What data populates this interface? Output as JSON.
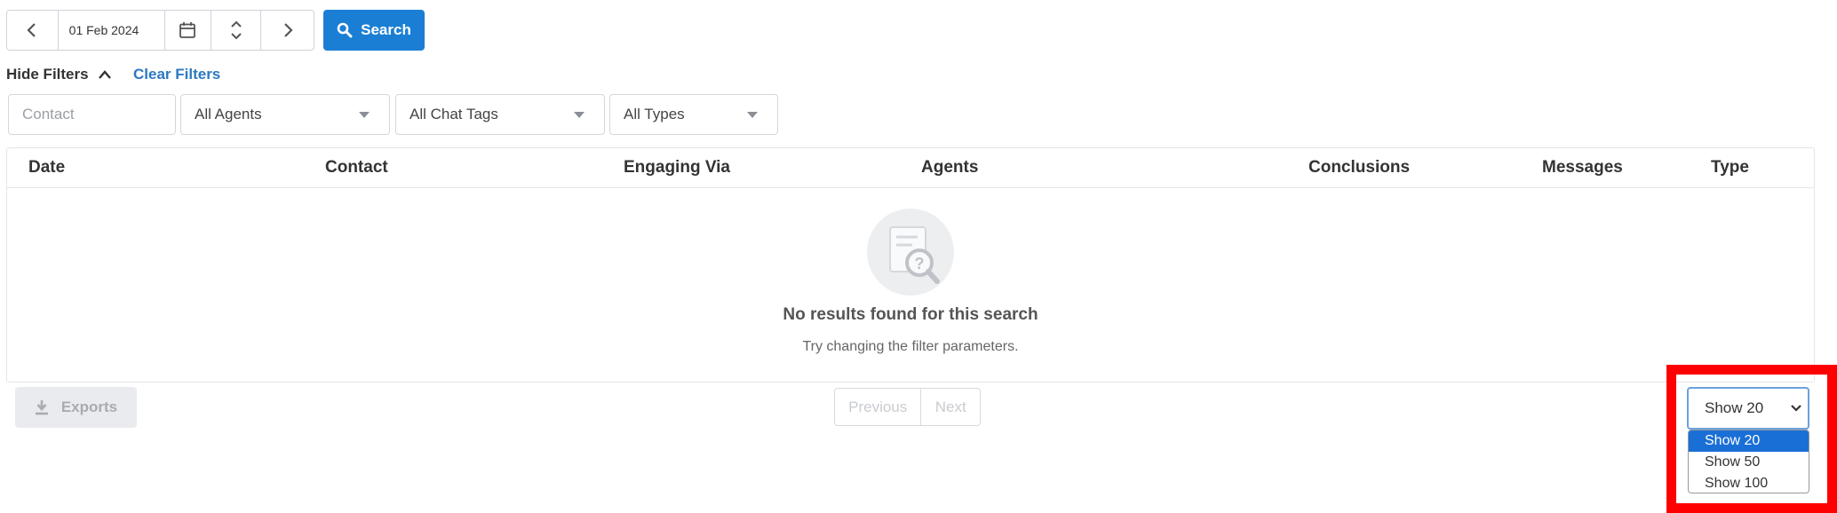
{
  "date_nav": {
    "date_value": "01 Feb 2024",
    "search_label": "Search"
  },
  "filters": {
    "hide_label": "Hide Filters",
    "clear_label": "Clear Filters",
    "contact_placeholder": "Contact",
    "agents_value": "All Agents",
    "chat_tags_value": "All Chat Tags",
    "types_value": "All Types"
  },
  "table": {
    "columns": [
      "Date",
      "Contact",
      "Engaging Via",
      "Agents",
      "Conclusions",
      "Messages",
      "Type"
    ],
    "empty_title": "No results found for this search",
    "empty_subtitle": "Try changing the filter parameters."
  },
  "footer": {
    "exports_label": "Exports",
    "previous_label": "Previous",
    "next_label": "Next",
    "page_size": {
      "selected": "Show 20",
      "options": [
        "Show 20",
        "Show 50",
        "Show 100"
      ]
    }
  },
  "colors": {
    "accent": "#1a7fd4",
    "link": "#2b78c2",
    "highlight": "#ff0000",
    "option_selected": "#1a6fd6"
  }
}
